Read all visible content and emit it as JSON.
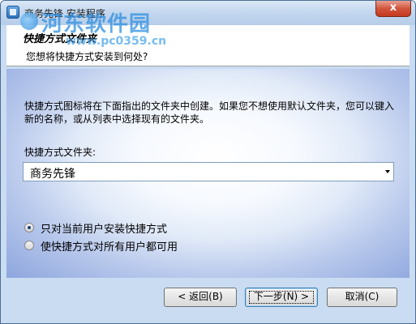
{
  "window": {
    "title": "商务先锋 安装程序",
    "close_symbol": "x"
  },
  "watermark": {
    "site_name": "河东软件园",
    "url": "www.pc0359.cn"
  },
  "header": {
    "title": "快捷方式文件夹",
    "subtitle": "您想将快捷方式安装到何处?"
  },
  "content": {
    "description": "快捷方式图标将在下面指出的文件夹中创建。如果您不想使用默认文件夹，您可以键入新的名称，或从列表中选择现有的文件夹。",
    "folder_label": "快捷方式文件夹:",
    "folder_value": "商务先锋",
    "options": [
      {
        "label": "只对当前用户安装快捷方式",
        "checked": true
      },
      {
        "label": "使快捷方式对所有用户都可用",
        "checked": false
      }
    ]
  },
  "buttons": {
    "back": "< 返回(B)",
    "next": "下一步(N) >",
    "cancel": "取消(C)"
  },
  "colors": {
    "frame": "#c9dcf2",
    "close_button": "#c9452c",
    "radio_dot": "#1e3e74"
  },
  "icons": {
    "app": "installer-icon",
    "close": "close-icon",
    "dropdown": "chevron-down-icon"
  }
}
